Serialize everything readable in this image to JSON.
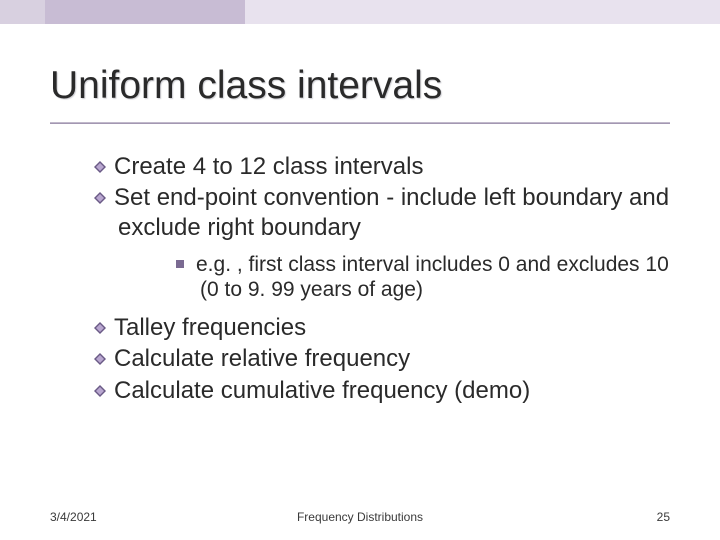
{
  "title": "Uniform class intervals",
  "bullets": {
    "b1": "Create 4 to 12 class intervals",
    "b2": "Set end-point convention - include left boundary and exclude right boundary",
    "b2_sub1": "e.g. , first class interval includes 0 and excludes 10 (0 to 9. 99 years of age)",
    "b3": "Talley frequencies",
    "b4": "Calculate relative frequency",
    "b5": "Calculate cumulative frequency (demo)"
  },
  "footer": {
    "date": "3/4/2021",
    "center": "Frequency Distributions",
    "page": "25"
  }
}
